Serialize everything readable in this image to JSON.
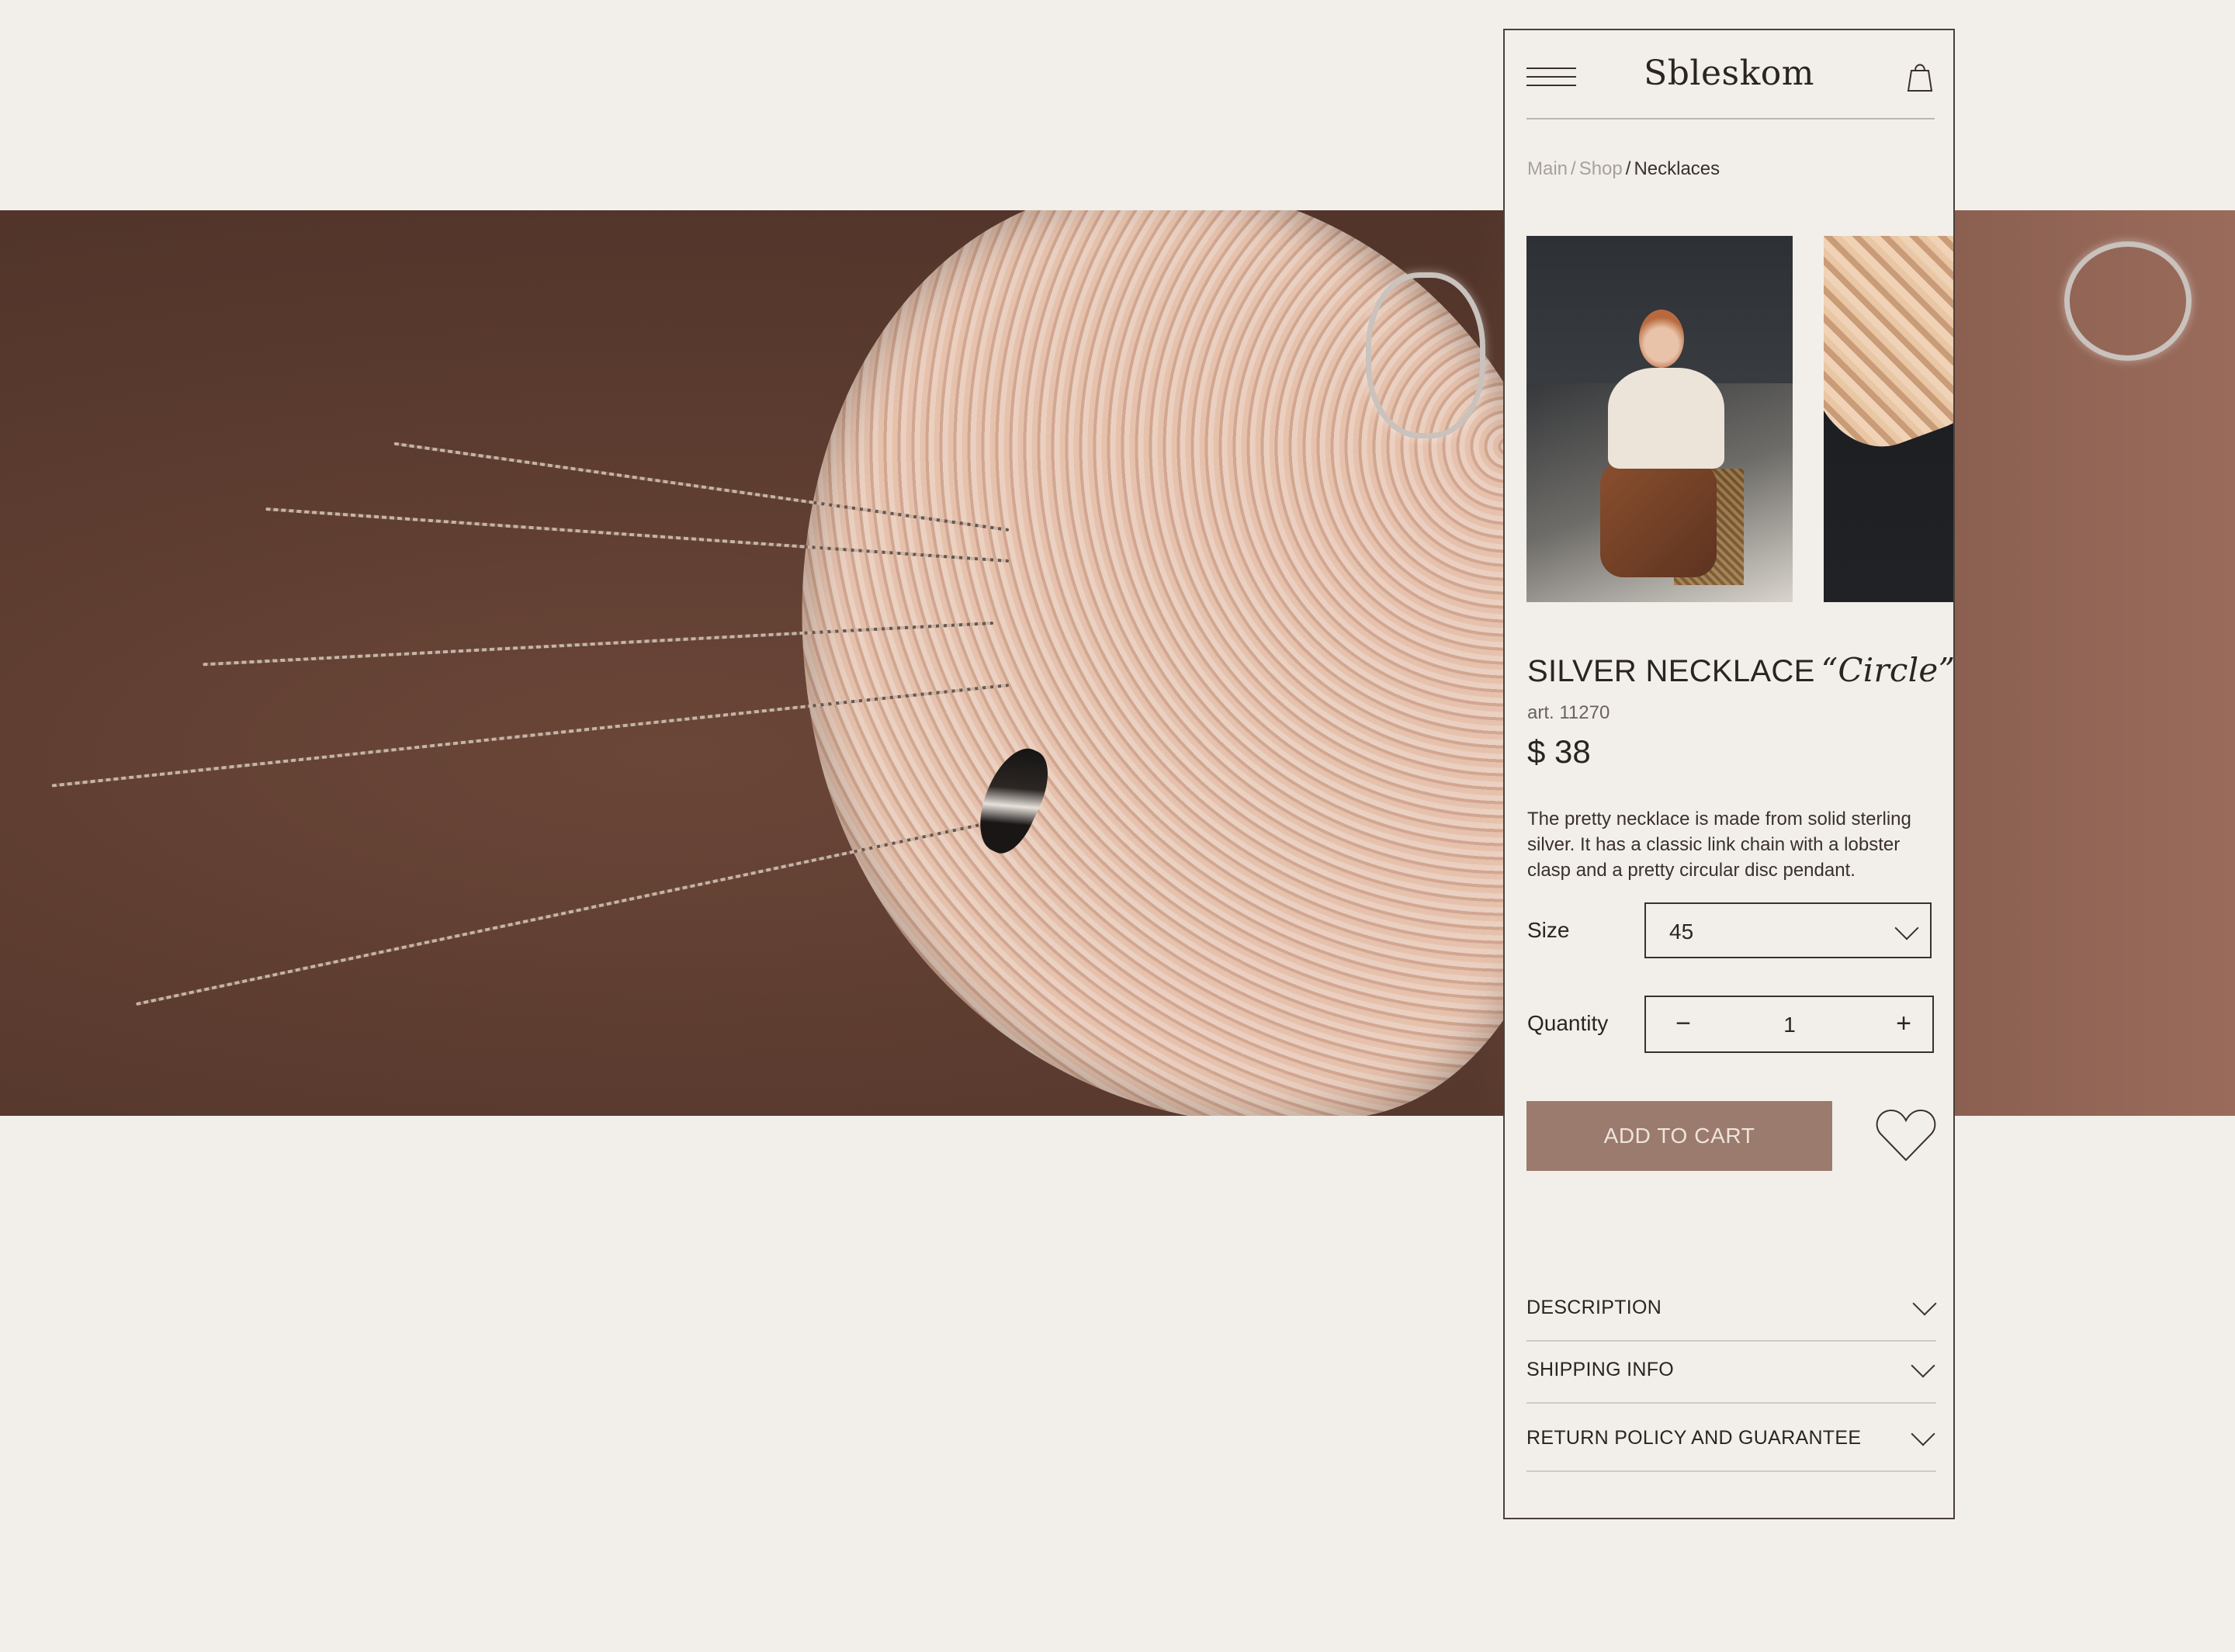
{
  "header": {
    "logo": "Sbleskom",
    "menu_icon": "hamburger-menu-icon",
    "cart_icon": "shopping-bag-icon"
  },
  "breadcrumb": {
    "items": [
      "Main",
      "Shop"
    ],
    "separator": "/",
    "current": "Necklaces"
  },
  "gallery": {
    "images": [
      "model-wearing-necklace-photo",
      "silk-fabric-photo"
    ]
  },
  "product": {
    "name": "SILVER NECKLACE",
    "name_script": "“Circle”",
    "article": "art. 11270",
    "price": "$ 38",
    "description": "The pretty necklace is made from solid sterling silver. It has a classic link chain with a lobster clasp and a pretty circular disc pendant."
  },
  "options": {
    "size_label": "Size",
    "size_value": "45",
    "quantity_label": "Quantity",
    "quantity_value": "1",
    "minus": "−",
    "plus": "+"
  },
  "actions": {
    "add_to_cart": "ADD TO CART",
    "wishlist_icon": "heart-icon"
  },
  "accordion": [
    {
      "label": "DESCRIPTION"
    },
    {
      "label": "SHIPPING INFO"
    },
    {
      "label": "RETURN POLICY AND GUARANTEE"
    }
  ],
  "colors": {
    "page_background": "#f2efea",
    "accent_button": "#9b7b6d",
    "text_dark": "#2b2422",
    "hero_brown": "#5b3b2f"
  }
}
